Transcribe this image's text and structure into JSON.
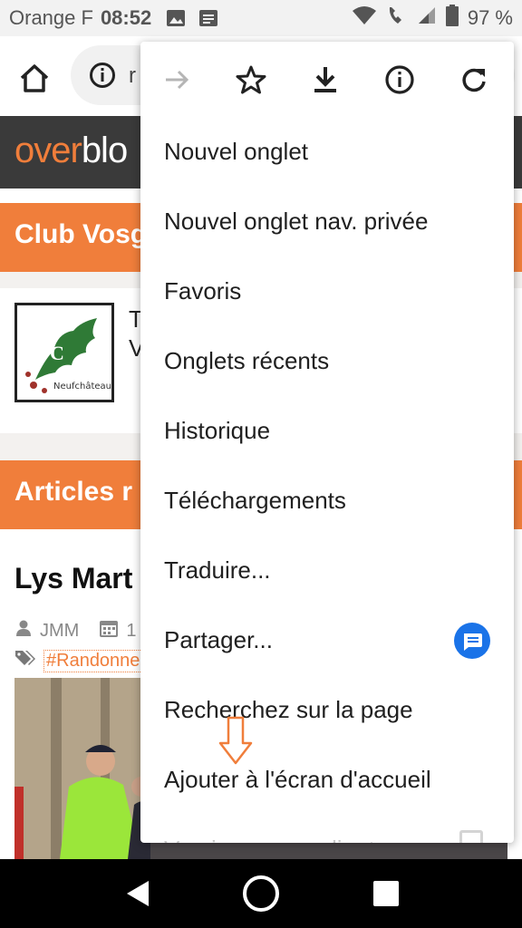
{
  "status_bar": {
    "carrier": "Orange F",
    "time": "08:52",
    "battery": "97 %",
    "icons": [
      "image-icon",
      "message-icon",
      "wifi-icon",
      "wifi-call-icon",
      "signal-icon",
      "battery-icon"
    ]
  },
  "address_bar": {
    "url_visible": "r",
    "icons": [
      "home-icon",
      "info-icon"
    ]
  },
  "page": {
    "logo_part1": "over",
    "logo_part2": "blo",
    "club_header": "Club Vosg",
    "club_text_line1": "T",
    "club_text_line2": "V",
    "club_logo_caption": "Neufchâteau",
    "articles_header": "Articles r",
    "article_title": "Lys Mart",
    "author": "JMM",
    "date_start": "1",
    "tag": "#Randonne"
  },
  "menu": {
    "top_icons": [
      "forward-icon",
      "star-icon",
      "download-icon",
      "info-icon",
      "refresh-icon"
    ],
    "items": [
      {
        "label": "Nouvel onglet"
      },
      {
        "label": "Nouvel onglet nav. privée"
      },
      {
        "label": "Favoris"
      },
      {
        "label": "Onglets récents"
      },
      {
        "label": "Historique"
      },
      {
        "label": "Téléchargements"
      },
      {
        "label": "Traduire..."
      },
      {
        "label": "Partager..."
      },
      {
        "label": "Recherchez sur la page"
      },
      {
        "label": "Ajouter à l'écran d'accueil"
      },
      {
        "label": "Version pour ordinat"
      }
    ]
  },
  "nav_bar": {
    "icons": [
      "back-icon",
      "home-circle-icon",
      "recent-apps-icon"
    ]
  },
  "colors": {
    "accent_orange": "#f07e3b",
    "header_dark": "#3a3a3a",
    "share_blue": "#1a73e8"
  }
}
